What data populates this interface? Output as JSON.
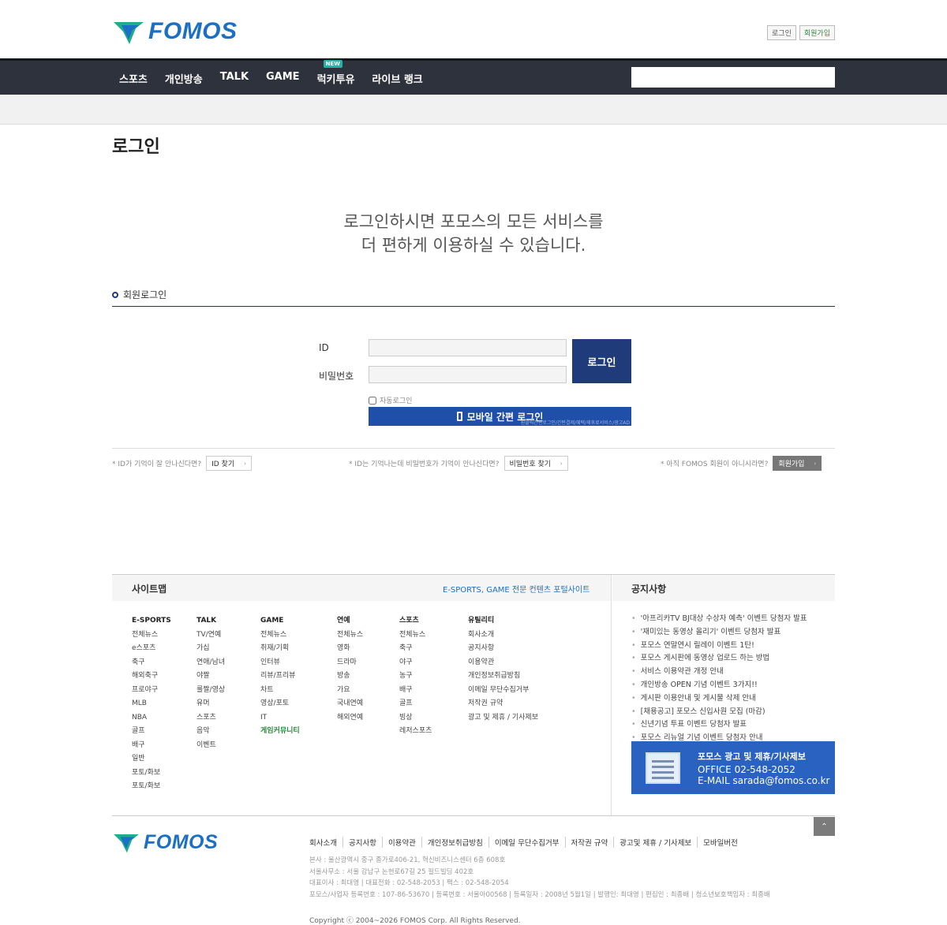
{
  "brand": {
    "name": "FOMOS",
    "color": "#1b6fc4",
    "mark_color": "#1fae8c"
  },
  "top_links": {
    "login": "로그인",
    "join": "회원가입"
  },
  "nav": {
    "items": [
      "스포츠",
      "개인방송",
      "TALK",
      "GAME",
      "럭키투유",
      "라이브 랭크"
    ],
    "new_badge": "NEW",
    "search_placeholder": ""
  },
  "page": {
    "title": "로그인",
    "intro_line1": "로그인하시면 포모스의 모든 서비스를",
    "intro_line2": "더 편하게 이용하실 수 있습니다."
  },
  "login_form": {
    "section_title": "회원로그인",
    "id_label": "ID",
    "pw_label": "비밀번호",
    "id_value": "",
    "pw_value": "",
    "submit": "로그인",
    "auto_login": "자동로그인",
    "mobile_login": "모바일 간편 로그인",
    "mobile_sub": "원클릭간편로그인/간편결제/혜택/제휴료서비스/광고AD"
  },
  "help": {
    "id_q": "* ID가 기억이 잘 안나신다면?",
    "id_btn": "ID 찾기",
    "pw_q": "* ID는 기억나는데 비밀번호가 기억이 안나신다면?",
    "pw_btn": "비밀번호 찾기",
    "join_q": "* 아직 FOMOS 회원이 아니시라면?",
    "join_btn": "회원가입",
    "arrow": "›"
  },
  "sitemap": {
    "title": "사이트맵",
    "tagline": "E-SPORTS, GAME 전문 컨텐츠 포털사이트",
    "columns": [
      {
        "head": "E-SPORTS",
        "items": [
          "전체뉴스",
          "e스포츠",
          "축구",
          "해외축구",
          "프로야구",
          "MLB",
          "NBA",
          "골프",
          "배구",
          "일반",
          "포토/화보",
          "포토/화보"
        ]
      },
      {
        "head": "TALK",
        "items": [
          "TV/연예",
          "가십",
          "연애/남녀",
          "야짤",
          "룰짤/영상",
          "유머",
          "스포츠",
          "음악",
          "이벤트"
        ]
      },
      {
        "head": "GAME",
        "items": [
          "전체뉴스",
          "취재/기획",
          "인터뷰",
          "리뷰/프리뷰",
          "차트",
          "영상/포토",
          "IT"
        ],
        "highlight": "게임커뮤니티"
      },
      {
        "head": "연예",
        "items": [
          "전체뉴스",
          "영화",
          "드라마",
          "방송",
          "가요",
          "국내연예",
          "해외연예"
        ]
      },
      {
        "head": "스포츠",
        "items": [
          "전체뉴스",
          "축구",
          "야구",
          "농구",
          "배구",
          "골프",
          "빙상",
          "레저스포츠"
        ]
      },
      {
        "head": "유틸리티",
        "items": [
          "회사소개",
          "공지사항",
          "이용약관",
          "개인정보취급방침",
          "이메일 무단수집거부",
          "저작권 규약",
          "광고 및 제휴 / 기사제보"
        ]
      }
    ]
  },
  "notice": {
    "title": "공지사항",
    "items": [
      "'아프리카TV BJ대상 수상자 예측' 이벤트 당첨자 발표",
      "'재미있는 동영상 올리기' 이벤트 당첨자 발표",
      "포모스 연말연시 릴레이 이벤트 1탄!",
      "포모스 게시판에 동영상 업로드 하는 방법",
      "서비스 이용약관 개정 안내",
      "개인방송 OPEN 기념 이벤트 3가지!!",
      "게시판 이용안내 및 게시물 삭제 안내",
      "[채용공고] 포모스 신입사원 모집 (마감)",
      "신년기념 투표 이벤트 당첨자 발표",
      "포모스 리뉴얼 기념 이벤트 당첨자 안내"
    ]
  },
  "ad": {
    "title": "포모스 광고 및 제휴/기사제보",
    "office": "OFFICE   02-548-2052",
    "email": "E-MAIL   sarada@fomos.co.kr"
  },
  "footer": {
    "top_button": "⌃",
    "links": [
      "회사소개",
      "공지사항",
      "이용약관",
      "개인정보취급방침",
      "이메일 무단수집거부",
      "저작권 규약",
      "광고및 제휴 / 기사제보",
      "모바일버전"
    ],
    "info1": "본사 : 울산광역시 중구 종가로406-21, 혁신비즈니스센터 6층 608호",
    "info2": "서울사무소 : 서울 강남구 논현로67길 25 필드빌딩 402호",
    "info3": "대표이사 : 최대영 | 대표전화 : 02-548-2053 | 팩스 : 02-548-2054",
    "info4": "포모스/사업자 등록번호 : 107-86-53670 | 등록번호 : 서울아00568 | 등록일자 : 2008년 5월1일 | 발행인: 최대영 | 편집인 : 최종배 | 청소년보호책임자 : 최종배",
    "copyright": "Copyright ⓒ 2004~2026 FOMOS Corp. All Rights Reserved."
  }
}
